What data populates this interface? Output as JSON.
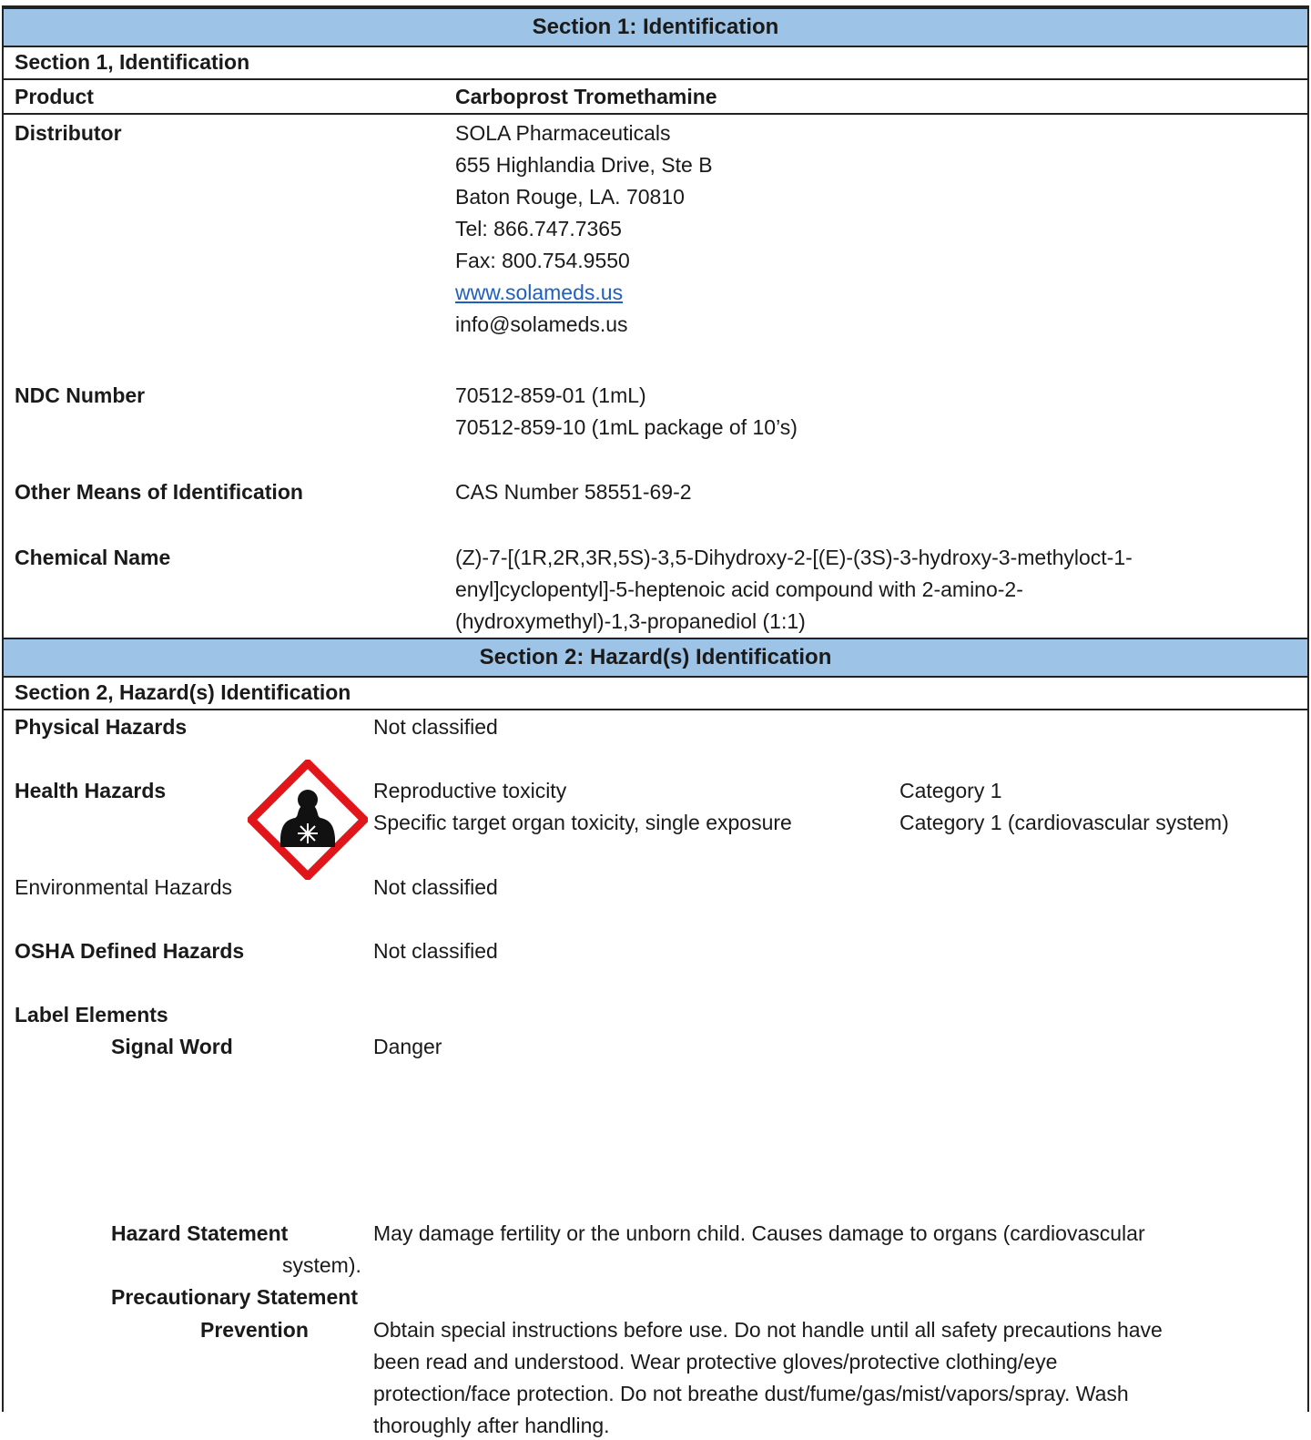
{
  "section1": {
    "header": "Section 1:  Identification",
    "subheader": "Section 1, Identification",
    "product": {
      "label": "Product",
      "value": "Carboprost Tromethamine"
    },
    "distributor": {
      "label": "Distributor",
      "lines": [
        "SOLA Pharmaceuticals",
        "655 Highlandia Drive, Ste B",
        "Baton Rouge, LA. 70810",
        "Tel:  866.747.7365",
        "Fax:  800.754.9550",
        "www.solameds.us",
        "info@solameds.us"
      ]
    },
    "ndc": {
      "label": "NDC Number",
      "lines": [
        "70512-859-01 (1mL)",
        "70512-859-10 (1mL package of 10’s)"
      ]
    },
    "other_id": {
      "label": "Other Means of Identification",
      "value": "CAS Number 58551-69-2"
    },
    "chemical_name": {
      "label": "Chemical Name",
      "lines": [
        "(Z)-7-[(1R,2R,3R,5S)-3,5-Dihydroxy-2-[(E)-(3S)-3-hydroxy-3-methyloct-1-",
        "enyl]cyclopentyl]-5-heptenoic acid compound with 2-amino-2-",
        "(hydroxymethyl)-1,3-propanediol (1:1)"
      ]
    }
  },
  "section2": {
    "header": "Section 2:  Hazard(s) Identification",
    "subheader": "Section 2, Hazard(s) Identification",
    "physical": {
      "label": "Physical Hazards",
      "value": "Not classified"
    },
    "health": {
      "label": "Health Hazards",
      "rows": [
        {
          "hazard": "Reproductive toxicity",
          "category": "Category 1"
        },
        {
          "hazard": "Specific target organ toxicity, single exposure",
          "category": "Category 1 (cardiovascular system)"
        }
      ]
    },
    "environmental": {
      "label": "Environmental Hazards",
      "value": "Not classified"
    },
    "osha": {
      "label": "OSHA Defined Hazards",
      "value": "Not classified"
    },
    "label_elements": "Label Elements",
    "signal_word": {
      "label": "Signal Word",
      "value": "Danger"
    },
    "pictogram": "health-hazard-icon",
    "hazard_statement": {
      "label": "Hazard Statement",
      "line1": "May damage fertility or the unborn child.  Causes damage to organs (cardiovascular",
      "line2": "system)."
    },
    "precautionary": {
      "label": "Precautionary Statement",
      "prevention_label": "Prevention",
      "lines": [
        "Obtain special instructions before use.  Do not handle until all safety precautions have",
        " been read and understood.  Wear protective gloves/protective clothing/eye",
        "protection/face protection.  Do not breathe dust/fume/gas/mist/vapors/spray.  Wash",
        " thoroughly after handling."
      ]
    }
  },
  "colors": {
    "header_band": "#9dc3e6",
    "link": "#1f5fbf",
    "pictogram_border": "#e0161b"
  }
}
